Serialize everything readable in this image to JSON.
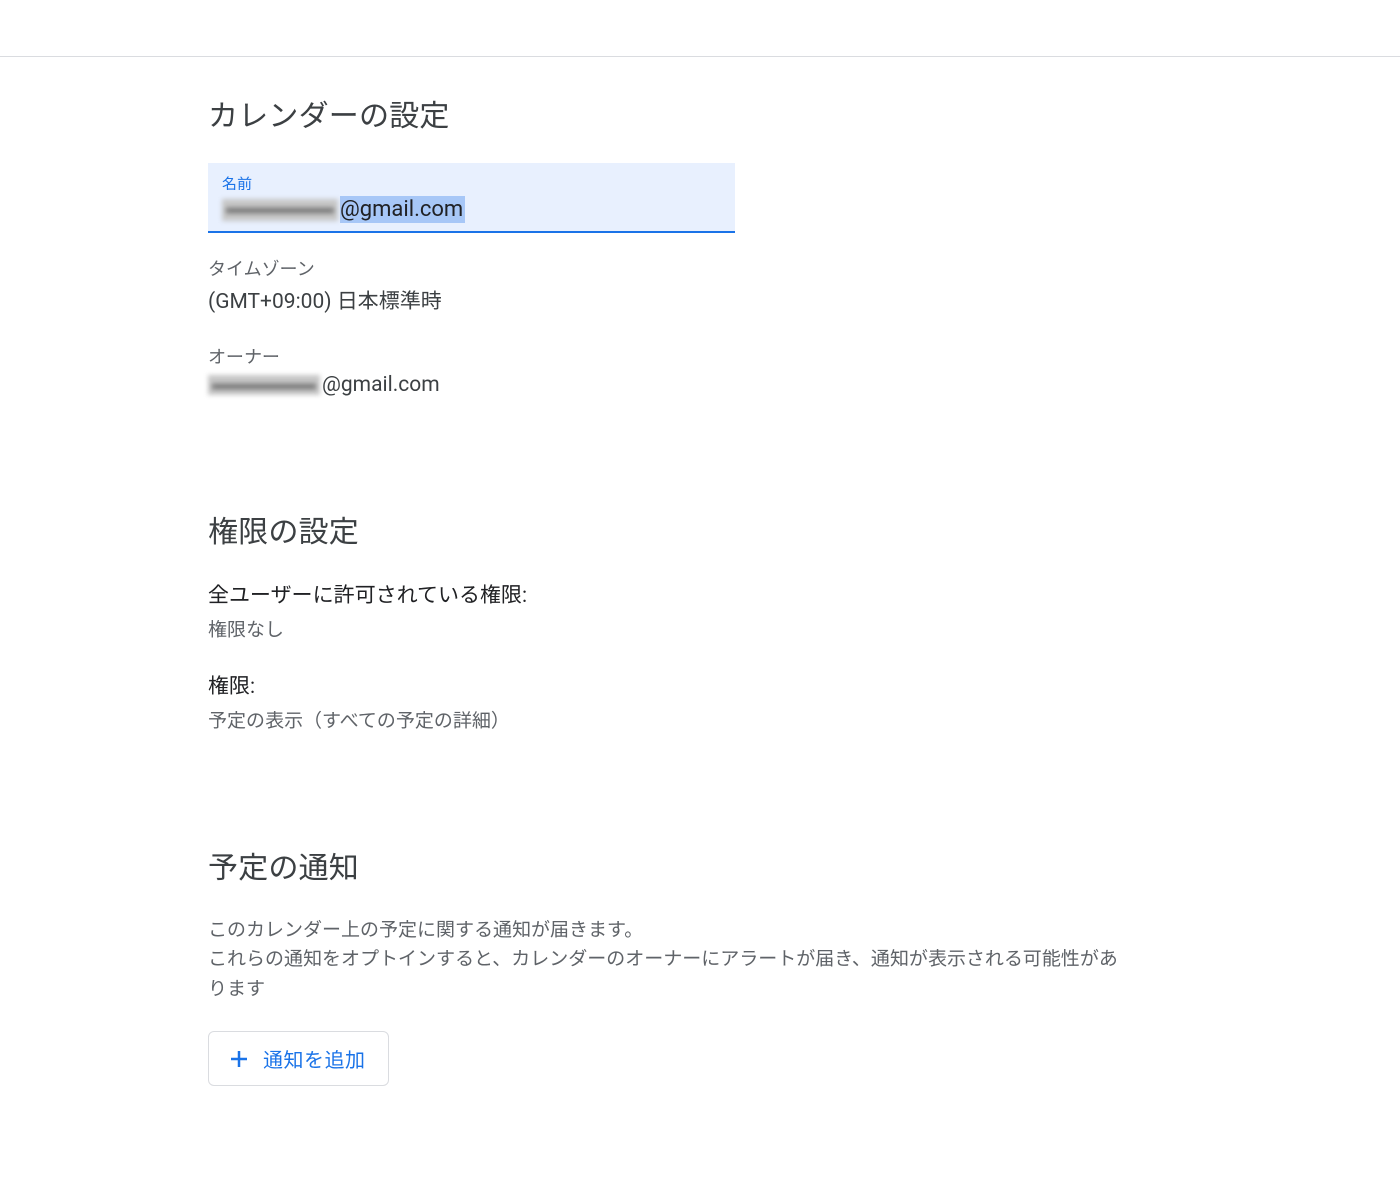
{
  "calendarSettings": {
    "title": "カレンダーの設定",
    "nameField": {
      "label": "名前",
      "valueSuffix": "@gmail.com"
    },
    "timezone": {
      "label": "タイムゾーン",
      "value": "(GMT+09:00) 日本標準時"
    },
    "owner": {
      "label": "オーナー",
      "valueSuffix": "@gmail.com"
    }
  },
  "permissionSettings": {
    "title": "権限の設定",
    "allUsers": {
      "label": "全ユーザーに許可されている権限:",
      "value": "権限なし"
    },
    "permission": {
      "label": "権限:",
      "value": "予定の表示（すべての予定の詳細）"
    }
  },
  "notifications": {
    "title": "予定の通知",
    "description": "このカレンダー上の予定に関する通知が届きます。\nこれらの通知をオプトインすると、カレンダーのオーナーにアラートが届き、通知が表示される可能性があります",
    "addButton": "通知を追加"
  }
}
